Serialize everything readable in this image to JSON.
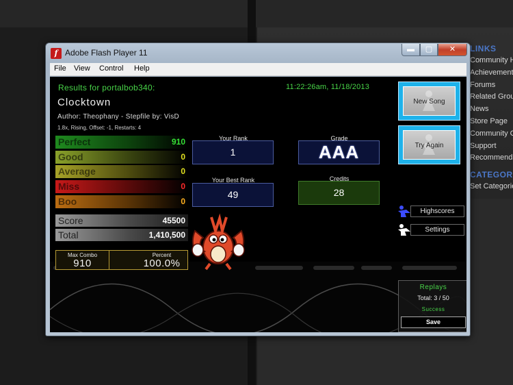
{
  "window": {
    "title": "Adobe Flash Player 11",
    "min_glyph": "▬",
    "max_glyph": "▢",
    "close_glyph": "✕",
    "icon_glyph": "f"
  },
  "menu": [
    "File",
    "View",
    "Control",
    "Help"
  ],
  "results": {
    "header": "Results for portalbob340:",
    "timestamp": "11:22:26am, 11/18/2013",
    "song": "Clocktown",
    "author_line": "Author: Theophany   -   Stepfile by: VisD",
    "settings_line": "1.8x, Rising, Offset: -1, Restarts: 4"
  },
  "judgements": [
    {
      "label": "Perfect",
      "value": "910",
      "color": "#36e036"
    },
    {
      "label": "Good",
      "value": "0",
      "color": "#e0e020"
    },
    {
      "label": "Average",
      "value": "0",
      "color": "#e0e020"
    },
    {
      "label": "Miss",
      "value": "0",
      "color": "#ff2a2a"
    },
    {
      "label": "Boo",
      "value": "0",
      "color": "#ffb020"
    }
  ],
  "score": {
    "label": "Score",
    "value": "45500"
  },
  "total": {
    "label": "Total",
    "value": "1,410,500"
  },
  "max_combo": {
    "label": "Max Combo",
    "value": "910"
  },
  "percent": {
    "label": "Percent",
    "value": "100.0%"
  },
  "your_rank": {
    "label": "Your Rank",
    "value": "1"
  },
  "best_rank": {
    "label": "Your Best Rank",
    "value": "49"
  },
  "grade": {
    "label": "Grade",
    "value": "AAA"
  },
  "credits": {
    "label": "Credits",
    "value": "28"
  },
  "buttons": {
    "new_song": "New Song",
    "try_again": "Try Again",
    "highscores": "Highscores",
    "settings": "Settings"
  },
  "replays": {
    "title": "Replays",
    "total": "Total: 3 / 50",
    "status": "Success",
    "save": "Save"
  },
  "sidebar": {
    "links_header": "LINKS",
    "links": [
      "Community Hub",
      "Achievements",
      "Forums",
      "Related Groups",
      "News",
      "Store Page",
      "Community Guides",
      "Support",
      "Recommendations"
    ],
    "categories_header": "CATEGORIES",
    "categories": [
      "Set Categories"
    ]
  },
  "colors": {
    "accent_green": "#48d448",
    "accent_blue": "#1eb2ea",
    "sidebar_header": "#4b77c8"
  }
}
